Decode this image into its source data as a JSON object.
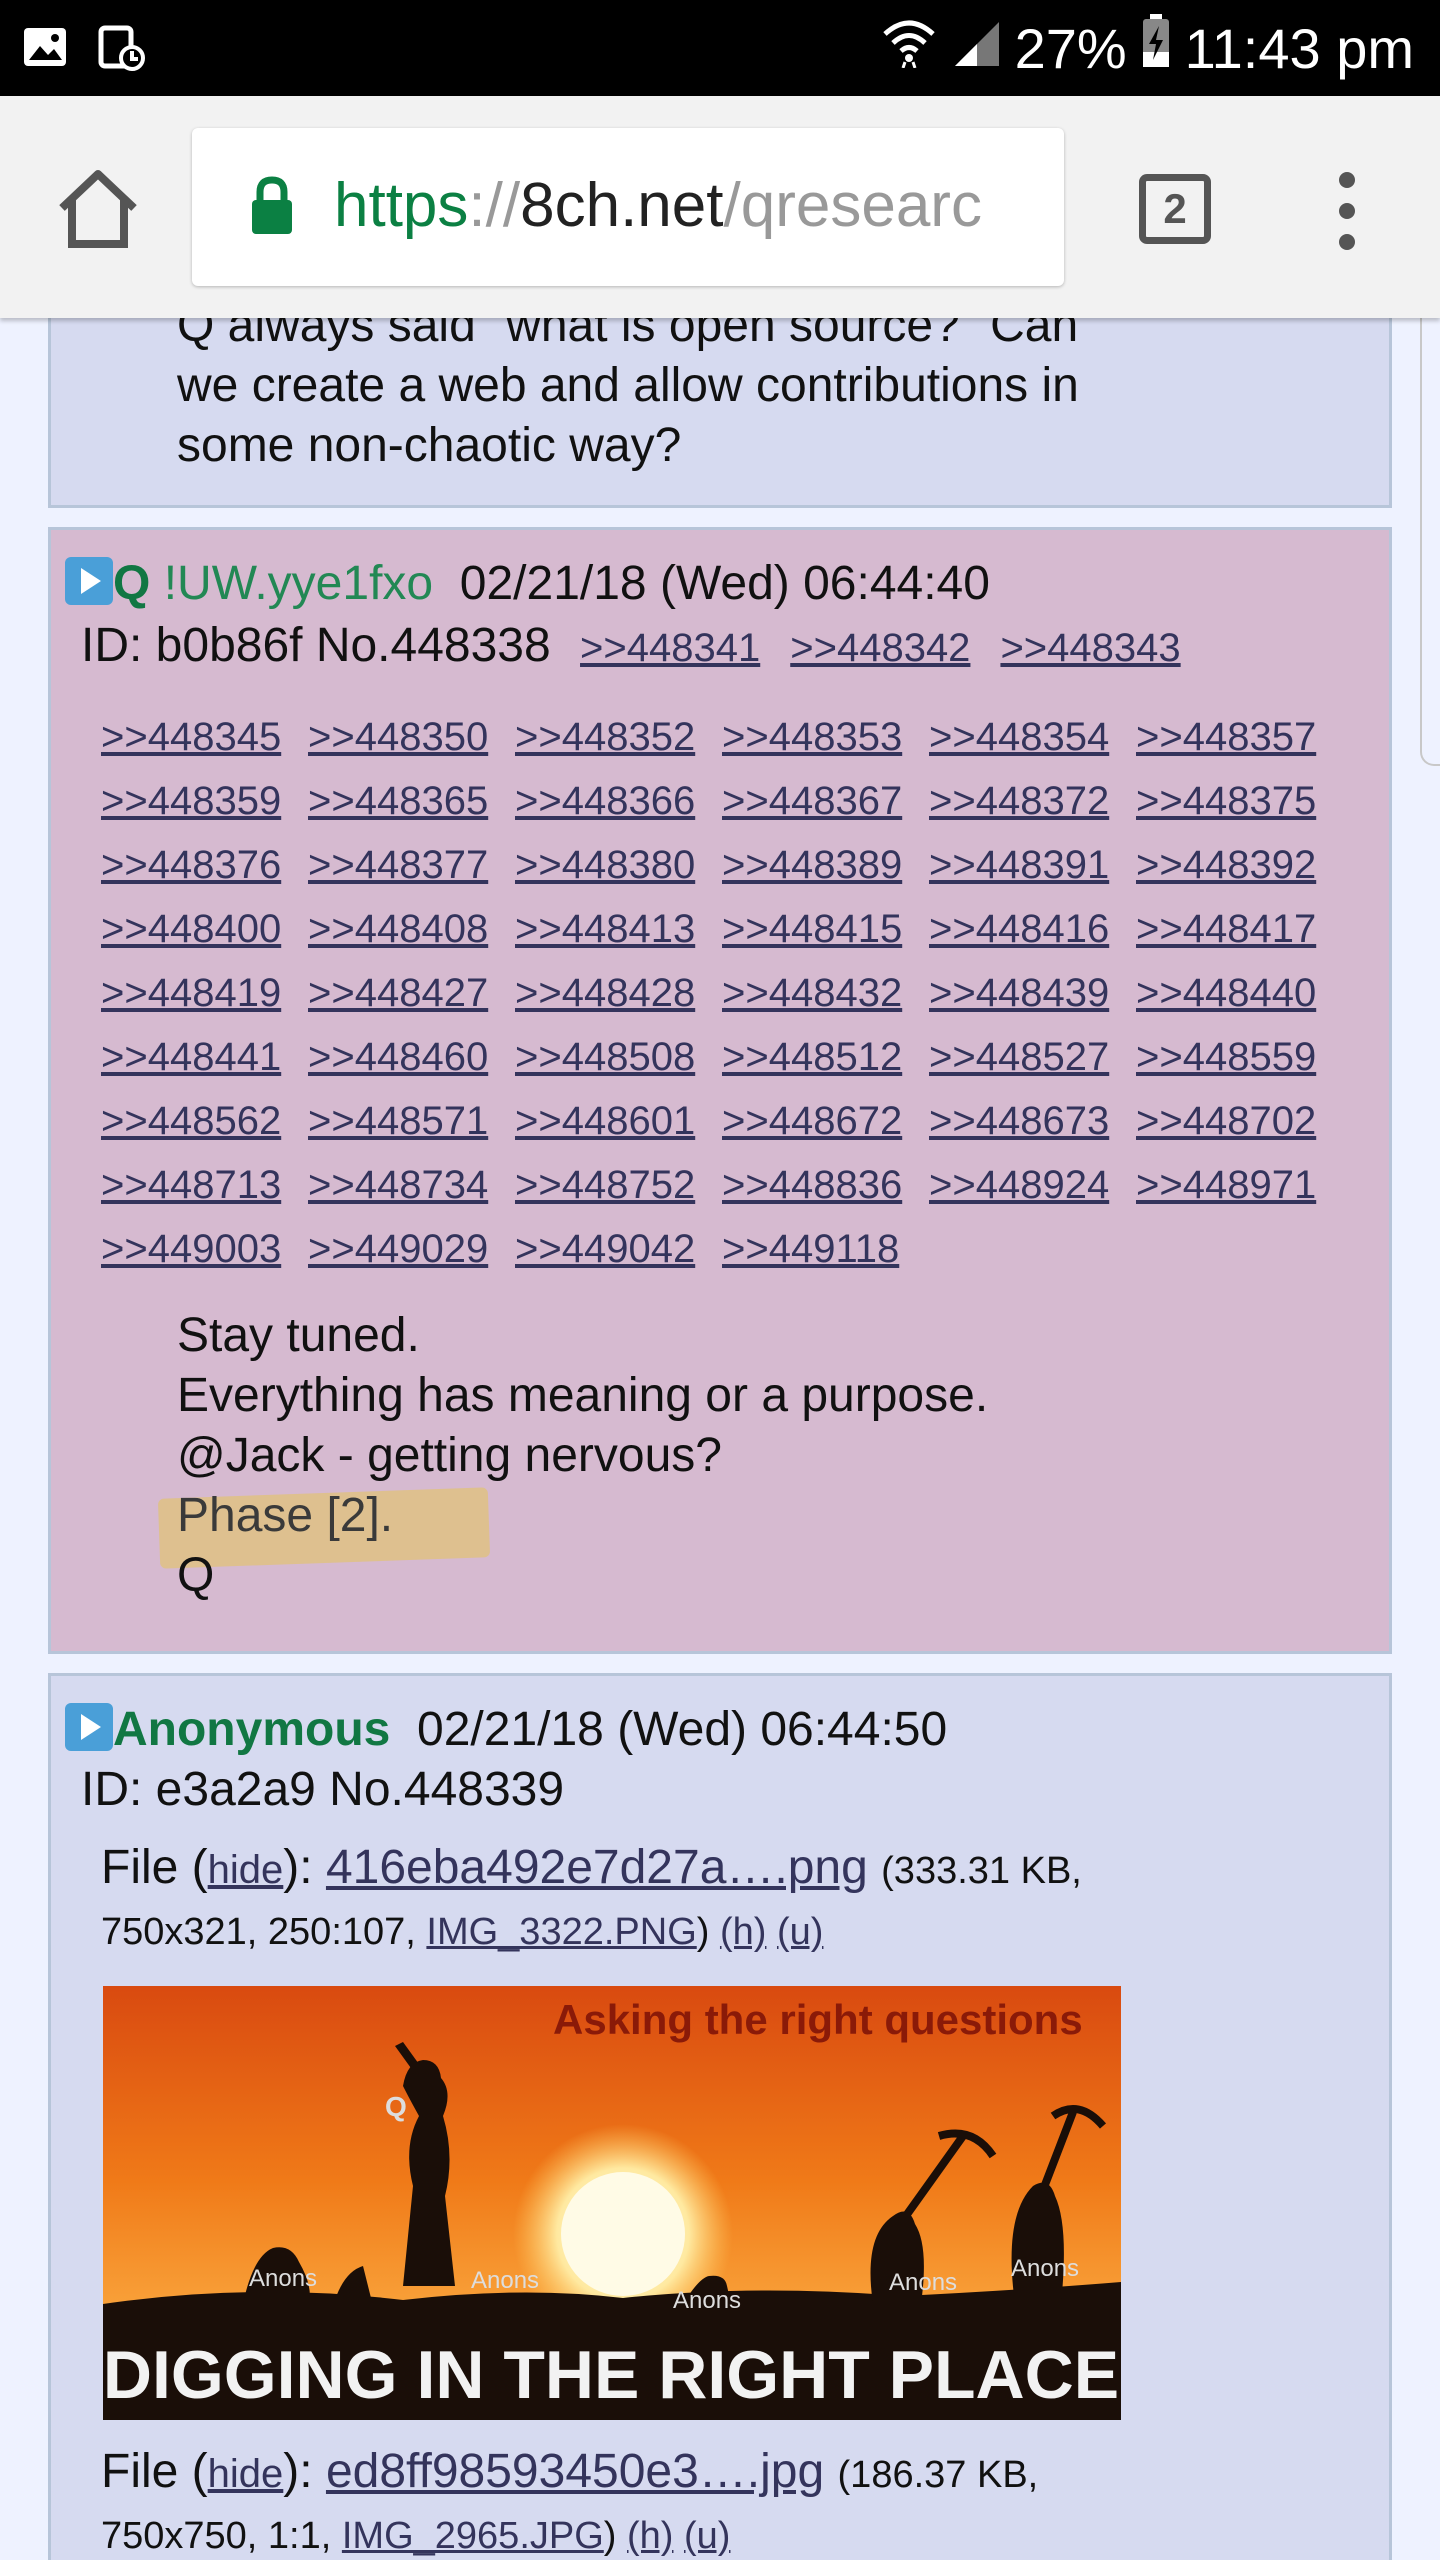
{
  "status_bar": {
    "battery": "27%",
    "time": "11:43 pm",
    "left_icons": [
      "image-notification-icon",
      "screenshot-notification-icon"
    ],
    "right_icons": [
      "wifi-icon",
      "signal-icon",
      "battery-charging-icon"
    ]
  },
  "browser": {
    "url_scheme": "https",
    "url_sep": "://",
    "url_host": "8ch.net",
    "url_path": "/qresearc",
    "tab_count": "2"
  },
  "posts": {
    "previous": {
      "body_lines": [
        "Q always said \"what is open source?\" Can",
        "we create a web and allow contributions in",
        "some non-chaotic way?"
      ]
    },
    "q_post": {
      "name": "Q",
      "tripcode": "!UW.yye1fxo",
      "date": "02/21/18 (Wed) 06:44:40",
      "id_line": "ID: b0b86f No.448338",
      "inline_backlinks": [
        ">>448341",
        ">>448342",
        ">>448343"
      ],
      "backlinks": [
        ">>448345",
        ">>448350",
        ">>448352",
        ">>448353",
        ">>448354",
        ">>448357",
        ">>448359",
        ">>448365",
        ">>448366",
        ">>448367",
        ">>448372",
        ">>448375",
        ">>448376",
        ">>448377",
        ">>448380",
        ">>448389",
        ">>448391",
        ">>448392",
        ">>448400",
        ">>448408",
        ">>448413",
        ">>448415",
        ">>448416",
        ">>448417",
        ">>448419",
        ">>448427",
        ">>448428",
        ">>448432",
        ">>448439",
        ">>448440",
        ">>448441",
        ">>448460",
        ">>448508",
        ">>448512",
        ">>448527",
        ">>448559",
        ">>448562",
        ">>448571",
        ">>448601",
        ">>448672",
        ">>448673",
        ">>448702",
        ">>448713",
        ">>448734",
        ">>448752",
        ">>448836",
        ">>448924",
        ">>448971",
        ">>449003",
        ">>449029",
        ">>449042",
        ">>449118"
      ],
      "body_lines": [
        "Stay tuned.",
        "Everything has meaning or a purpose.",
        "@Jack - getting nervous?",
        "Phase [2].",
        "Q"
      ],
      "highlight_color": "#e6c45a"
    },
    "anon_post": {
      "name": "Anonymous",
      "date": "02/21/18 (Wed) 06:44:50",
      "id_line": "ID: e3a2a9 No.448339",
      "file1": {
        "label": "File",
        "hide": "hide",
        "filename": "416eba492e7d27a….png",
        "size": "(333.31 KB,",
        "dims": "750x321, 250:107,",
        "orig": "IMG_3322.PNG",
        "h": "(h)",
        "u": "(u)"
      },
      "image": {
        "top_text": "Asking the right questions",
        "bottom_text": "DIGGING IN THE RIGHT PLACE",
        "figure_label": "Q",
        "anon_labels": [
          "Anons",
          "Anons",
          "Anons",
          "Anons",
          "Anons"
        ]
      },
      "file2": {
        "label": "File",
        "hide": "hide",
        "filename": "ed8ff98593450e3….jpg",
        "size": "(186.37 KB,",
        "dims": "750x750, 1:1,",
        "orig": "IMG_2965.JPG",
        "h": "(h)",
        "u": "(u)"
      }
    }
  }
}
